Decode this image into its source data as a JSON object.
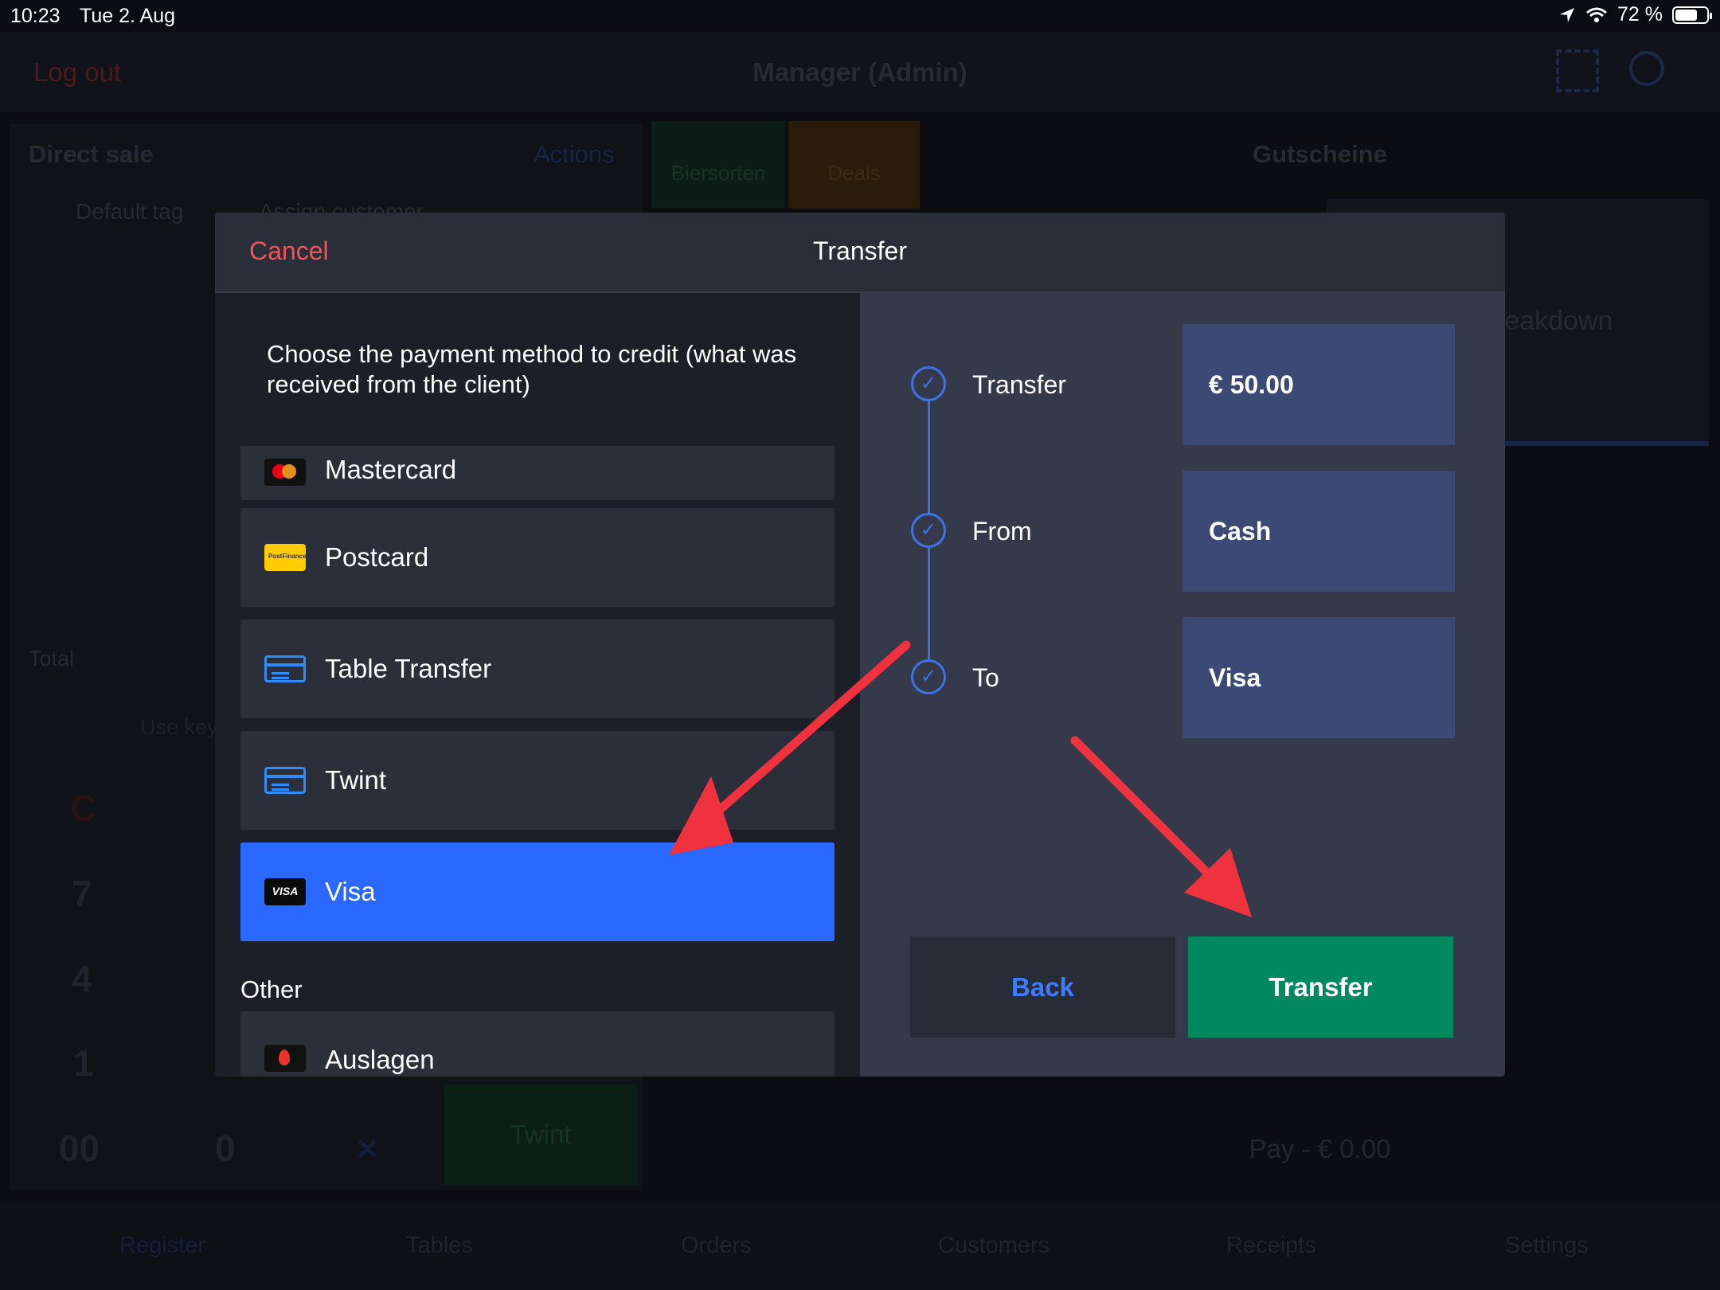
{
  "status_bar": {
    "time": "10:23",
    "date": "Tue 2. Aug",
    "battery": "72 %"
  },
  "background": {
    "logout": "Log out",
    "nav_title": "Manager (Admin)",
    "direct_sale": "Direct sale",
    "actions": "Actions",
    "default_tag": "Default tag",
    "assign_customer": "Assign customer",
    "total": "Total",
    "use_keypad": "Use key",
    "keys": [
      "C",
      "7",
      "4",
      "1",
      "00",
      "0",
      "×"
    ],
    "twint_button": "Twint",
    "categories": [
      "Biersorten",
      "Deals"
    ],
    "gutscheine": "Gutscheine",
    "breakdown": "reakdown",
    "pay": "Pay - € 0.00",
    "tabs": [
      "Register",
      "Tables",
      "Orders",
      "Customers",
      "Receipts",
      "Settings"
    ]
  },
  "modal": {
    "cancel": "Cancel",
    "title": "Transfer",
    "instruction": "Choose the payment method to credit (what was received from the client)",
    "methods": [
      {
        "label": "Mastercard",
        "icon": "mastercard-icon"
      },
      {
        "label": "Postcard",
        "icon": "postfinance-icon"
      },
      {
        "label": "Table Transfer",
        "icon": "card-icon"
      },
      {
        "label": "Twint",
        "icon": "card-icon"
      },
      {
        "label": "Visa",
        "icon": "visa-icon",
        "selected": true
      }
    ],
    "other_section": "Other",
    "other_methods": [
      {
        "label": "Auslagen",
        "icon": "lightspeed-icon"
      }
    ],
    "steps": [
      {
        "label": "Transfer",
        "value": "€ 50.00"
      },
      {
        "label": "From",
        "value": "Cash"
      },
      {
        "label": "To",
        "value": "Visa"
      }
    ],
    "back_button": "Back",
    "transfer_button": "Transfer"
  },
  "colors": {
    "cancel": "#f2545b",
    "selected": "#2b68ff",
    "transfer": "#00895d",
    "arrow": "#f0313e"
  }
}
